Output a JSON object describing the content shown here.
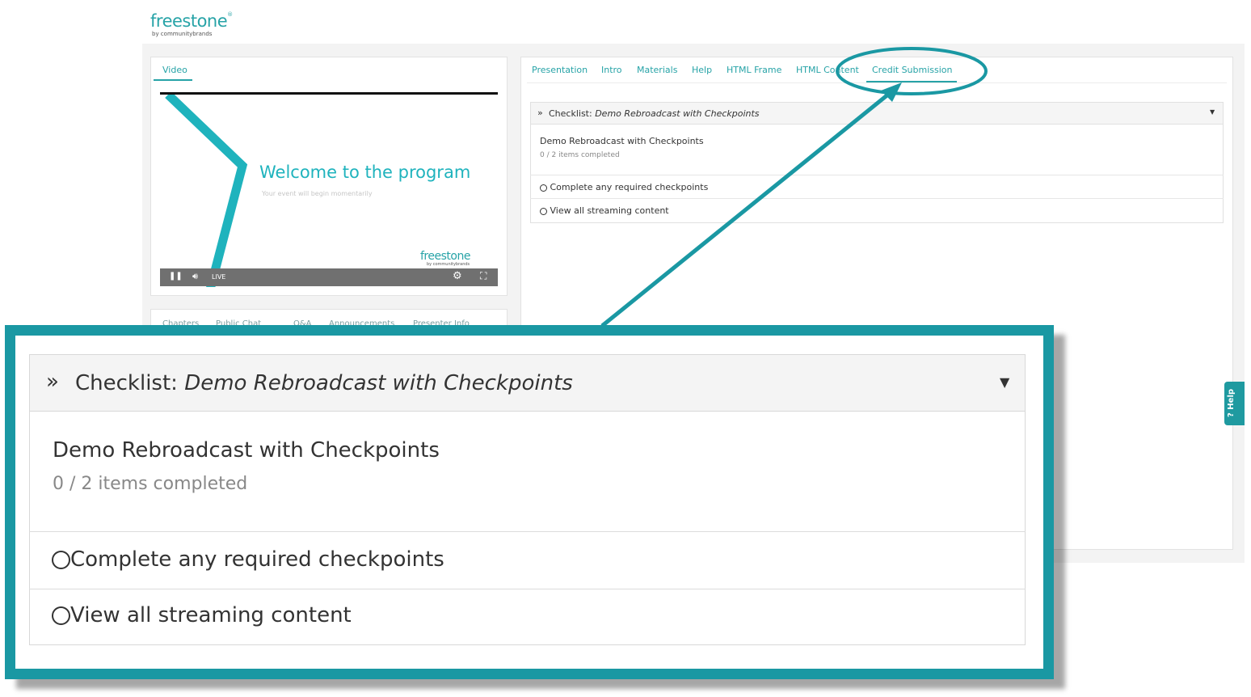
{
  "app": {
    "logo": "freestone",
    "logo_sub": "by communitybrands"
  },
  "video_panel": {
    "tab": "Video",
    "player": {
      "headline": "Welcome to the program",
      "subline": "Your event will begin momentarily",
      "logo": "freestone",
      "logo_sub": "by communitybrands",
      "live_label": "LIVE"
    },
    "lower_tabs": [
      "Chapters",
      "Public Chat",
      "Q&A",
      "Announcements",
      "Presenter Info"
    ]
  },
  "right_panel": {
    "tabs": [
      "Presentation",
      "Intro",
      "Materials",
      "Help",
      "HTML Frame",
      "HTML Content",
      "Credit Submission"
    ],
    "active_tab": "Credit Submission"
  },
  "checklist": {
    "prefix": "Checklist:",
    "name": "Demo Rebroadcast with Checkpoints",
    "title": "Demo Rebroadcast with Checkpoints",
    "progress": "0 / 2 items completed",
    "items": [
      "Complete any required checkpoints",
      "View all streaming content"
    ]
  },
  "help_tab": {
    "label": "Help"
  },
  "colors": {
    "accent": "#1a98a3",
    "brand": "#27a3a7",
    "text": "#333333",
    "muted": "#888888"
  },
  "icons": [
    "double-chevron-right-icon",
    "caret-down-icon",
    "circle-icon",
    "pause-icon",
    "volume-icon",
    "gear-icon",
    "fullscreen-icon",
    "question-icon"
  ]
}
